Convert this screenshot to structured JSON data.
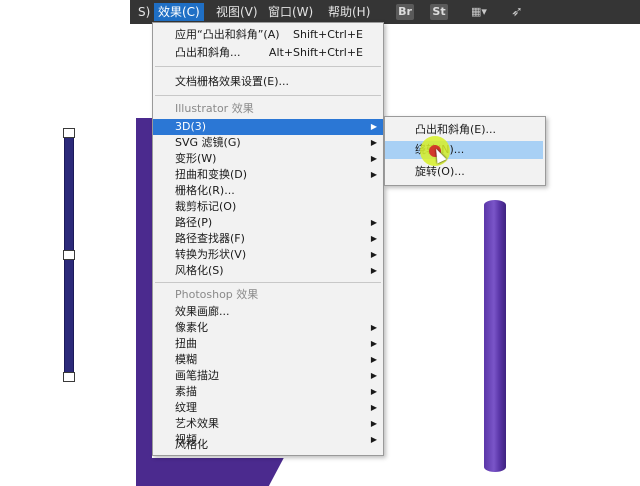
{
  "menubar": {
    "items": [
      {
        "label": "S)"
      },
      {
        "label": "效果(C)",
        "active": true
      },
      {
        "label": "视图(V)"
      },
      {
        "label": "窗口(W)"
      },
      {
        "label": "帮助(H)"
      }
    ],
    "toolbar_icons": [
      {
        "name": "bridge-icon",
        "glyph": "Br"
      },
      {
        "name": "stock-icon",
        "glyph": "St"
      },
      {
        "name": "arrange-documents-icon",
        "glyph": "▦▾"
      },
      {
        "name": "send-icon",
        "glyph": "➶"
      }
    ]
  },
  "effect_menu": {
    "apply_last": {
      "label": "应用“凸出和斜角”(A)",
      "shortcut": "Shift+Ctrl+E"
    },
    "last_effect": {
      "label": "凸出和斜角...",
      "shortcut": "Alt+Shift+Ctrl+E"
    },
    "raster_settings": {
      "label": "文档栅格效果设置(E)..."
    },
    "illustrator_header": "Illustrator 效果",
    "illustrator_items": [
      {
        "label": "3D(3)",
        "submenu": true,
        "highlighted": true
      },
      {
        "label": "SVG 滤镜(G)",
        "submenu": true
      },
      {
        "label": "变形(W)",
        "submenu": true
      },
      {
        "label": "扭曲和变换(D)",
        "submenu": true
      },
      {
        "label": "栅格化(R)..."
      },
      {
        "label": "裁剪标记(O)"
      },
      {
        "label": "路径(P)",
        "submenu": true
      },
      {
        "label": "路径查找器(F)",
        "submenu": true
      },
      {
        "label": "转换为形状(V)",
        "submenu": true
      },
      {
        "label": "风格化(S)",
        "submenu": true
      }
    ],
    "photoshop_header": "Photoshop 效果",
    "photoshop_items": [
      {
        "label": "效果画廊..."
      },
      {
        "label": "像素化",
        "submenu": true
      },
      {
        "label": "扭曲",
        "submenu": true
      },
      {
        "label": "模糊",
        "submenu": true
      },
      {
        "label": "画笔描边",
        "submenu": true
      },
      {
        "label": "素描",
        "submenu": true
      },
      {
        "label": "纹理",
        "submenu": true
      },
      {
        "label": "艺术效果",
        "submenu": true
      },
      {
        "label": "视频",
        "submenu": true
      },
      {
        "label": "风格化",
        "submenu": true
      }
    ]
  },
  "submenu_3d": {
    "items": [
      {
        "label": "凸出和斜角(E)..."
      },
      {
        "label": "绕转(N)...",
        "highlighted": true
      },
      {
        "label": "旋转(O)..."
      }
    ]
  },
  "colors": {
    "menubar_bg": "#353535",
    "highlight": "#2b77d5",
    "submenu_highlight": "#a8d0f5",
    "purple_art": "#4b2a8e",
    "cylinder": "#6a45b8"
  }
}
